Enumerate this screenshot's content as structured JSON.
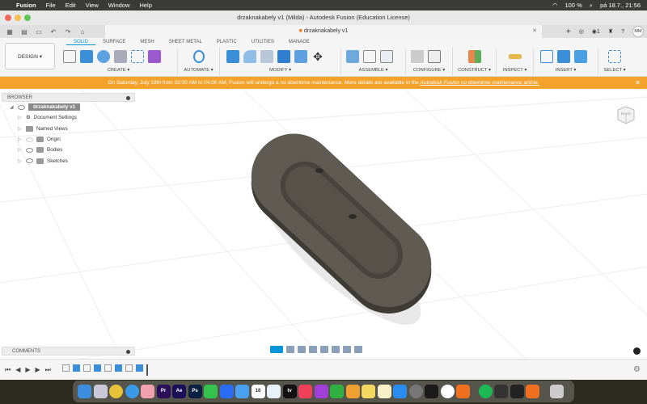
{
  "menubar": {
    "app": "Fusion",
    "items": [
      "File",
      "Edit",
      "View",
      "Window",
      "Help"
    ],
    "battery": "100 %",
    "datetime": "pá 18.7., 21:56"
  },
  "window": {
    "title": "drzaknakabely v1 (Milda) - Autodesk Fusion (Education License)"
  },
  "tab": {
    "label": "drzaknakabely v1",
    "avatar": "MM",
    "jobs": "1"
  },
  "ribbon": {
    "workspace": "DESIGN ▾",
    "tabs": [
      "SOLID",
      "SURFACE",
      "MESH",
      "SHEET METAL",
      "PLASTIC",
      "UTILITIES",
      "MANAGE"
    ],
    "groups": [
      "CREATE ▾",
      "AUTOMATE ▾",
      "MODIFY ▾",
      "ASSEMBLE ▾",
      "CONFIGURE ▾",
      "CONSTRUCT ▾",
      "INSPECT ▾",
      "INSERT ▾",
      "SELECT ▾"
    ]
  },
  "banner": {
    "text": "On Saturday, July 19th from 02:00 AM to 04:00 AM, Fusion will undergo a no downtime maintenance. More details are available in the ",
    "link": "Autodesk Fusion no downtime maintenance article.",
    "close": "✕"
  },
  "browser": {
    "title": "BROWSER",
    "root": "drzaknakabely v1",
    "nodes": [
      "Document Settings",
      "Named Views",
      "Origin",
      "Bodies",
      "Sketches"
    ]
  },
  "viewcube": {
    "face": "BACK"
  },
  "comments": {
    "title": "COMMENTS"
  },
  "dock": {
    "apps": [
      "Finder",
      "Launchpad",
      "Chrome",
      "Safari",
      "Photos",
      "Pr",
      "Ae",
      "Ps",
      "WhatsApp",
      "Messenger",
      "Mail",
      "18",
      "Freeform",
      "tv",
      "Music",
      "Podcasts",
      "Numbers",
      "Pages",
      "Notes",
      "Notes",
      "App Store",
      "Settings",
      "QuickTime",
      "Clock",
      "Fusion",
      "Spotify",
      "Capture",
      "Infuse",
      "Fusion",
      "Trash"
    ],
    "calendar_day": "18"
  }
}
